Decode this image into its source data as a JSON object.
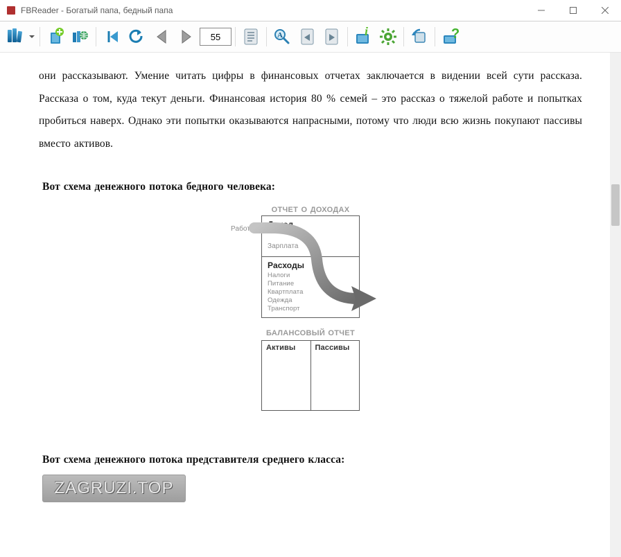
{
  "window": {
    "title": "FBReader - Богатый папа, бедный папа"
  },
  "toolbar": {
    "page_number": "55"
  },
  "content": {
    "paragraph": "они рассказывают. Умение читать цифры в финансовых отчетах заключается в видении всей сути рассказа. Рассказа о том, куда текут деньги. Финансовая история 80 % семей – это рассказ о тяжелой работе и попытках пробиться наверх. Однако эти попытки оказываются напрасными, потому что люди всю жизнь покупают пассивы вместо активов.",
    "heading1": "Вот схема денежного потока бедного человека:",
    "heading2": "Вот схема денежного потока представителя среднего класса:"
  },
  "diagram": {
    "income_title": "ОТЧЕТ О ДОХОДАХ",
    "work_label": "Работа",
    "income_header": "Доход",
    "income_sub": "Зарплата",
    "expense_header": "Расходы",
    "expense_items": "Налоги\nПитание\nКвартплата\nОдежда\nТранспорт",
    "balance_title": "БАЛАНСОВЫЙ ОТЧЕТ",
    "assets": "Активы",
    "liabilities": "Пассивы"
  },
  "watermark": "ZAGRUZI.TOP"
}
